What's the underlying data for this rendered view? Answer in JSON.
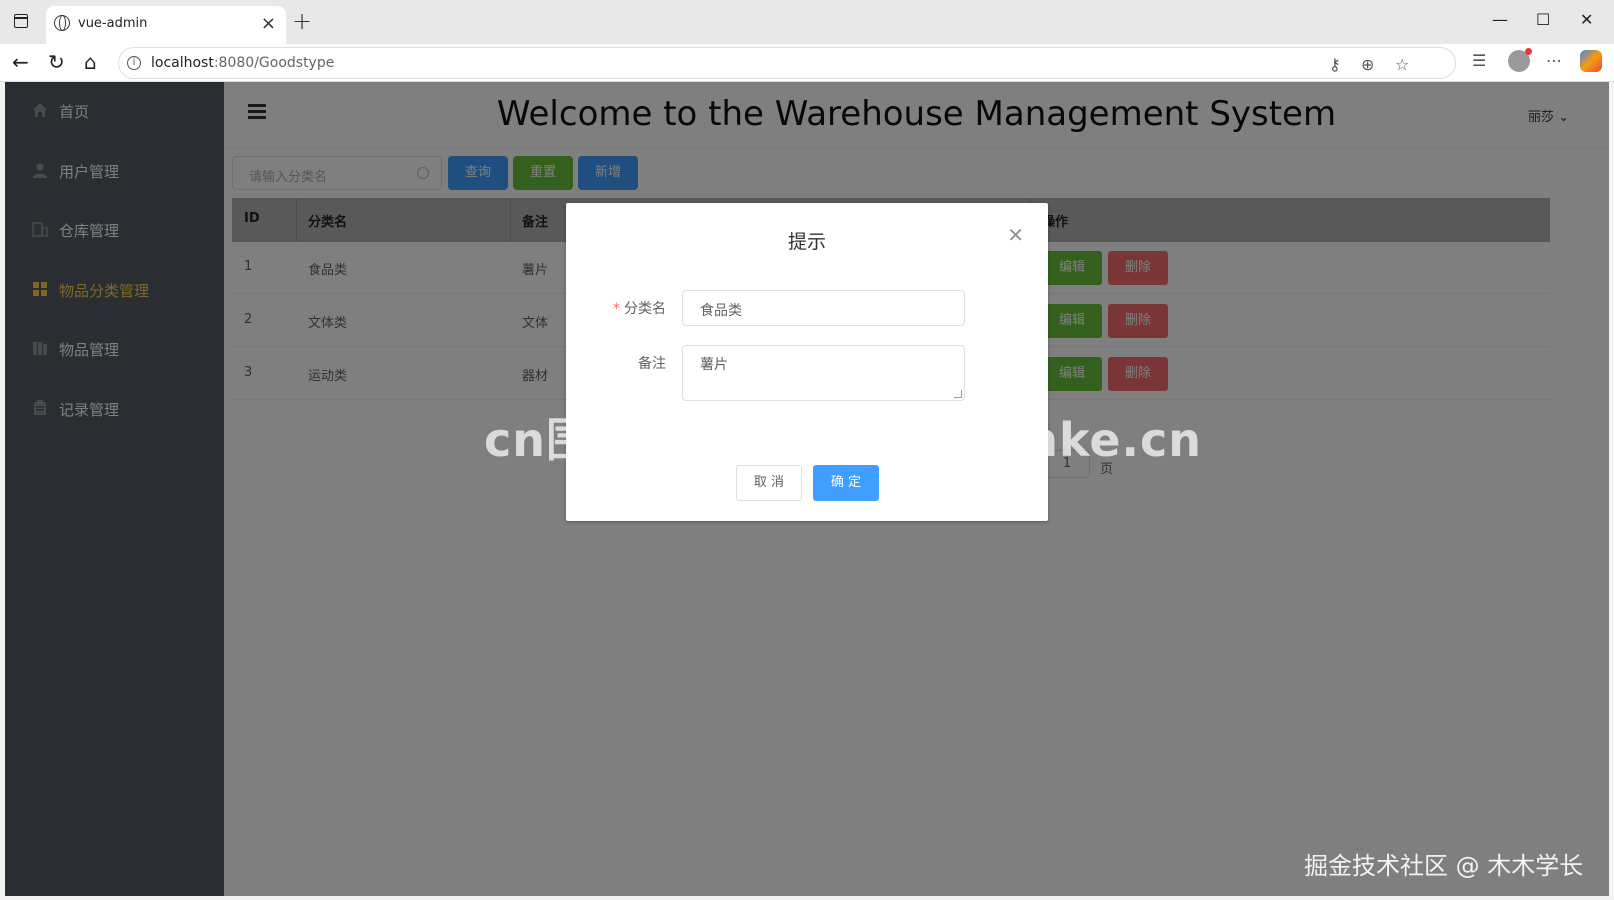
{
  "browser": {
    "tab_title": "vue-admin",
    "url_host": "localhost",
    "url_rest": ":8080/Goodstype",
    "win_minimize": "—",
    "win_maximize": "☐",
    "win_close": "✕"
  },
  "sidebar": {
    "items": [
      {
        "label": "首页",
        "icon": "home-icon",
        "active": false
      },
      {
        "label": "用户管理",
        "icon": "user-icon",
        "active": false
      },
      {
        "label": "仓库管理",
        "icon": "warehouse-icon",
        "active": false
      },
      {
        "label": "物品分类管理",
        "icon": "grid-icon",
        "active": true
      },
      {
        "label": "物品管理",
        "icon": "goods-icon",
        "active": false
      },
      {
        "label": "记录管理",
        "icon": "record-icon",
        "active": false
      }
    ],
    "bg_color": "#545c64",
    "active_color": "#ffd04b"
  },
  "header": {
    "title": "Welcome to the Warehouse Management System",
    "user": "丽莎"
  },
  "toolbar": {
    "search_placeholder": "请输入分类名",
    "query_label": "查询",
    "reset_label": "重置",
    "add_label": "新增"
  },
  "table": {
    "columns": [
      "ID",
      "分类名",
      "备注",
      "操作"
    ],
    "rows": [
      {
        "id": "1",
        "name": "食品类",
        "remark": "薯片"
      },
      {
        "id": "2",
        "name": "文体类",
        "remark": "文体"
      },
      {
        "id": "3",
        "name": "运动类",
        "remark": "器材"
      }
    ],
    "edit_label": "编辑",
    "delete_label": "删除"
  },
  "pagination": {
    "page_value": "1",
    "page_suffix": "页"
  },
  "dialog": {
    "title": "提示",
    "name_label": "分类名",
    "name_value": "食品类",
    "remark_label": "备注",
    "remark_value": "薯片",
    "cancel_label": "取 消",
    "ok_label": "确 定"
  },
  "watermarks": {
    "center": "cn围观客www.weiguanke.cn",
    "corner": "掘金技术社区 @ 木木学长"
  }
}
